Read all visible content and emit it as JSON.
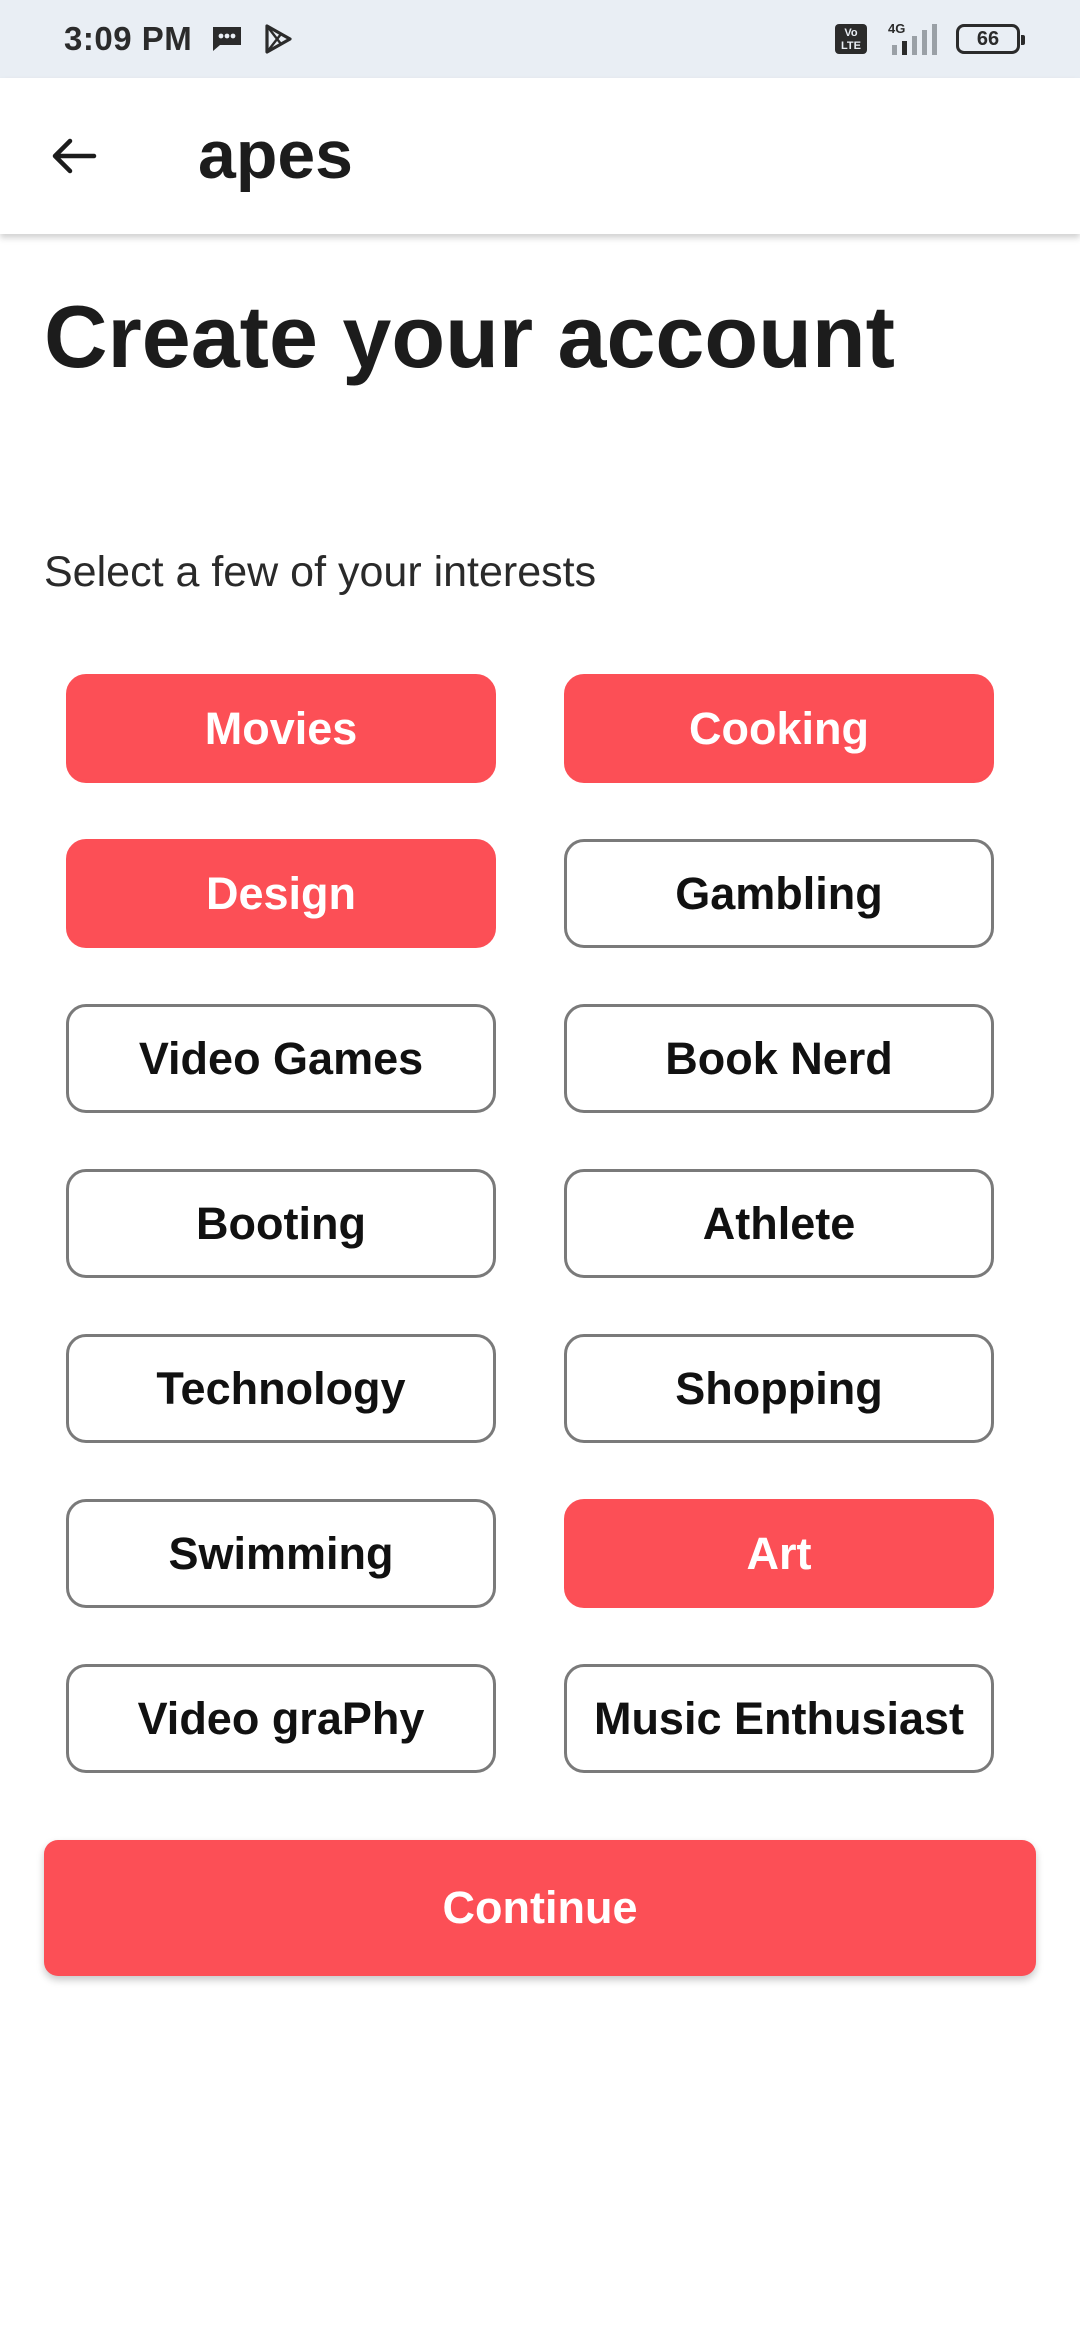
{
  "status_bar": {
    "time": "3:09 PM",
    "icons": [
      "message-icon",
      "play-store-icon",
      "volte-icon",
      "signal-4g-icon"
    ],
    "network_label": "4G",
    "volte_label": "Vo LTE",
    "battery": "66"
  },
  "appbar": {
    "back_icon": "arrow-left-icon",
    "title": "apes"
  },
  "page": {
    "heading": "Create your account",
    "subheading": "Select a few of your interests"
  },
  "interests": [
    {
      "label": "Movies",
      "selected": true
    },
    {
      "label": "Cooking",
      "selected": true
    },
    {
      "label": "Design",
      "selected": true
    },
    {
      "label": "Gambling",
      "selected": false
    },
    {
      "label": "Video Games",
      "selected": false
    },
    {
      "label": "Book Nerd",
      "selected": false
    },
    {
      "label": "Booting",
      "selected": false
    },
    {
      "label": "Athlete",
      "selected": false
    },
    {
      "label": "Technology",
      "selected": false
    },
    {
      "label": "Shopping",
      "selected": false
    },
    {
      "label": "Swimming",
      "selected": false
    },
    {
      "label": "Art",
      "selected": true
    },
    {
      "label": "Video graPhy",
      "selected": false
    },
    {
      "label": "Music Enthusiast",
      "selected": false
    }
  ],
  "continue_label": "Continue",
  "colors": {
    "accent": "#fc4f56",
    "status_bar_bg": "#e9eef4",
    "chip_border": "#7a7a7a"
  }
}
